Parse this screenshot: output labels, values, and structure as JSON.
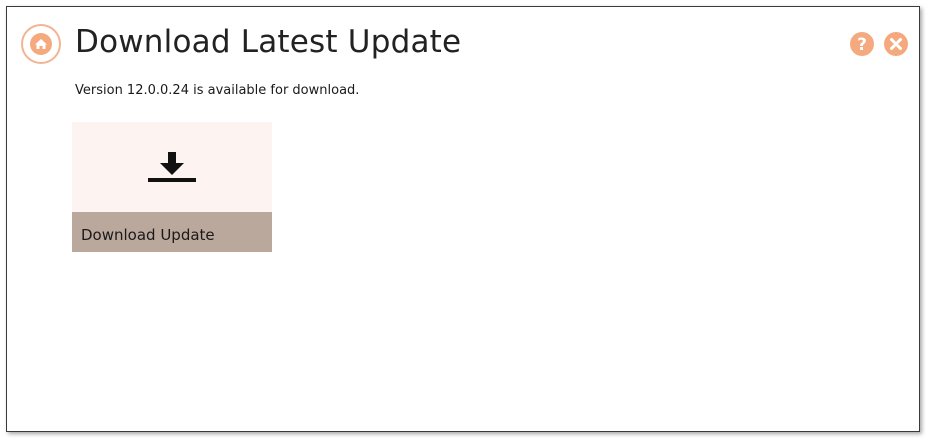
{
  "header": {
    "title": "Download Latest Update",
    "home_icon": "home-icon",
    "help_icon": "help-icon",
    "close_icon": "close-icon"
  },
  "main": {
    "version_text": "Version 12.0.0.24 is available for download.",
    "download_tile": {
      "label": "Download Update",
      "icon": "download-icon"
    }
  },
  "colors": {
    "accent": "#f4a97f",
    "home_border": "#f4b393",
    "tile_top": "#fdf3f0",
    "tile_bottom": "#bba89d"
  }
}
